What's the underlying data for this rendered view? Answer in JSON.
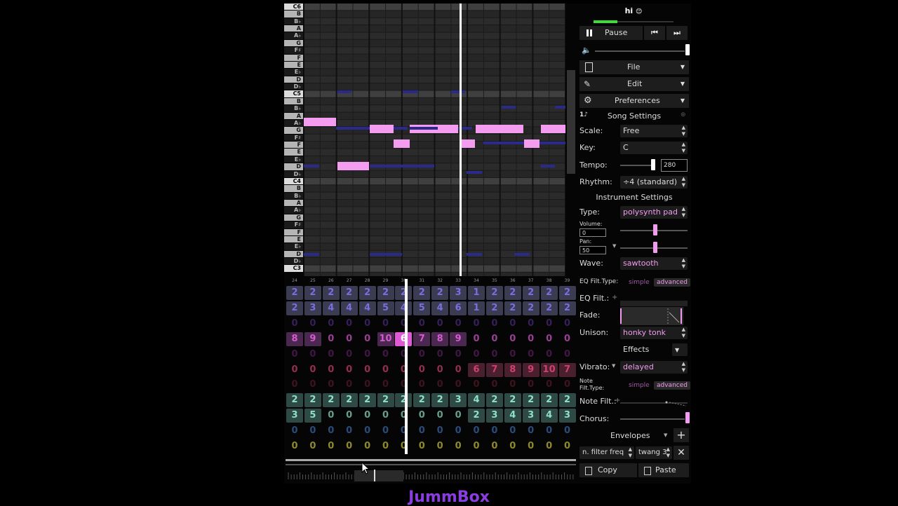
{
  "app_title": "JummBox",
  "song": {
    "name": "hi",
    "emoji": "😊"
  },
  "transport": {
    "pause_label": "Pause"
  },
  "menus": {
    "file": "File",
    "edit": "Edit",
    "preferences": "Preferences"
  },
  "song_settings": {
    "header": "Song Settings",
    "scale_label": "Scale:",
    "scale_value": "Free",
    "key_label": "Key:",
    "key_value": "C",
    "tempo_label": "Tempo:",
    "tempo_value": "280",
    "rhythm_label": "Rhythm:",
    "rhythm_value": "÷4 (standard)"
  },
  "instrument_settings": {
    "header": "Instrument Settings",
    "type_label": "Type:",
    "type_value": "polysynth pad",
    "volume_label": "Volume:",
    "volume_value": "0",
    "pan_label": "Pan:",
    "pan_value": "50",
    "wave_label": "Wave:",
    "wave_value": "sawtooth",
    "eq_filt_type_label": "EQ Filt.Type:",
    "simple": "simple",
    "advanced": "advanced",
    "eq_filt_label": "EQ Filt.:",
    "fade_label": "Fade:",
    "unison_label": "Unison:",
    "unison_value": "honky tonk",
    "effects_label": "Effects",
    "vibrato_label": "Vibrato:",
    "vibrato_value": "delayed",
    "note_filt_type_label": "Note\nFilt.Type:",
    "note_filt_label": "Note Filt.:",
    "chorus_label": "Chorus:",
    "envelopes_label": "Envelopes",
    "envelope_target": "n. filter freq",
    "envelope_curve": "twang 3"
  },
  "clipboard": {
    "copy": "Copy",
    "paste": "Paste"
  },
  "piano_keys": [
    "C6",
    "B",
    "B♭",
    "A",
    "A♭",
    "G",
    "F♯",
    "F",
    "E",
    "E♭",
    "D",
    "D♭",
    "C5",
    "B",
    "B♭",
    "A",
    "A♭",
    "G",
    "F♯",
    "F",
    "E",
    "E♭",
    "D",
    "D♭",
    "C4",
    "B",
    "B♭",
    "A",
    "A♭",
    "G",
    "F♯",
    "F",
    "E",
    "E♭",
    "D",
    "D♭",
    "C3"
  ],
  "bar_numbers": [
    "24",
    "25",
    "26",
    "27",
    "28",
    "29",
    "30",
    "31",
    "32",
    "33",
    "34",
    "35",
    "36",
    "37",
    "38",
    "39"
  ],
  "sequencer": {
    "rows": [
      {
        "color": "#7a6fe0",
        "bg": "#3b3b52",
        "values": [
          "2",
          "2",
          "2",
          "2",
          "2",
          "2",
          "2",
          "2",
          "2",
          "3",
          "1",
          "2",
          "2",
          "2",
          "2",
          "2"
        ]
      },
      {
        "color": "#7a6fe0",
        "bg": "#3b3b52",
        "values": [
          "2",
          "3",
          "4",
          "4",
          "4",
          "5",
          "4",
          "5",
          "4",
          "6",
          "1",
          "2",
          "2",
          "2",
          "2",
          "2"
        ]
      },
      {
        "color": "#4a2a7a",
        "bg": "",
        "values": [
          "0",
          "0",
          "0",
          "0",
          "0",
          "0",
          "0",
          "0",
          "0",
          "0",
          "0",
          "0",
          "0",
          "0",
          "0",
          "0"
        ]
      },
      {
        "color": "#d65ad0",
        "bg": "#4a2850",
        "values": [
          "8",
          "9",
          "0",
          "0",
          "0",
          "10",
          "6",
          "7",
          "8",
          "9",
          "0",
          "0",
          "0",
          "0",
          "0",
          "0"
        ]
      },
      {
        "color": "#5a2060",
        "bg": "",
        "values": [
          "0",
          "0",
          "0",
          "0",
          "0",
          "0",
          "0",
          "0",
          "0",
          "0",
          "0",
          "0",
          "0",
          "0",
          "0",
          "0"
        ]
      },
      {
        "color": "#d0406a",
        "bg": "#4a2030",
        "values": [
          "0",
          "0",
          "0",
          "0",
          "0",
          "0",
          "0",
          "0",
          "0",
          "0",
          "6",
          "7",
          "8",
          "9",
          "10",
          "7"
        ]
      },
      {
        "color": "#5a1a28",
        "bg": "",
        "values": [
          "0",
          "0",
          "0",
          "0",
          "0",
          "0",
          "0",
          "0",
          "0",
          "0",
          "0",
          "0",
          "0",
          "0",
          "0",
          "0"
        ]
      },
      {
        "color": "#8ee0c8",
        "bg": "#2f4a44",
        "values": [
          "2",
          "2",
          "2",
          "2",
          "2",
          "2",
          "2",
          "2",
          "2",
          "3",
          "4",
          "2",
          "2",
          "2",
          "2",
          "2"
        ]
      },
      {
        "color": "#8ee0c8",
        "bg": "#2f4a44",
        "values": [
          "3",
          "5",
          "0",
          "0",
          "0",
          "0",
          "0",
          "0",
          "0",
          "0",
          "2",
          "3",
          "4",
          "3",
          "4",
          "3"
        ]
      },
      {
        "color": "#3a6ab0",
        "bg": "",
        "values": [
          "0",
          "0",
          "0",
          "0",
          "0",
          "0",
          "0",
          "0",
          "0",
          "0",
          "0",
          "0",
          "0",
          "0",
          "0",
          "0"
        ]
      },
      {
        "color": "#c8c040",
        "bg": "",
        "values": [
          "0",
          "0",
          "0",
          "0",
          "0",
          "0",
          "0",
          "0",
          "0",
          "0",
          "0",
          "0",
          "0",
          "0",
          "0",
          "0"
        ]
      }
    ]
  },
  "colors": {
    "note": "#f49df0",
    "accent": "#8a3ee0",
    "playhead": "#ffffff"
  }
}
